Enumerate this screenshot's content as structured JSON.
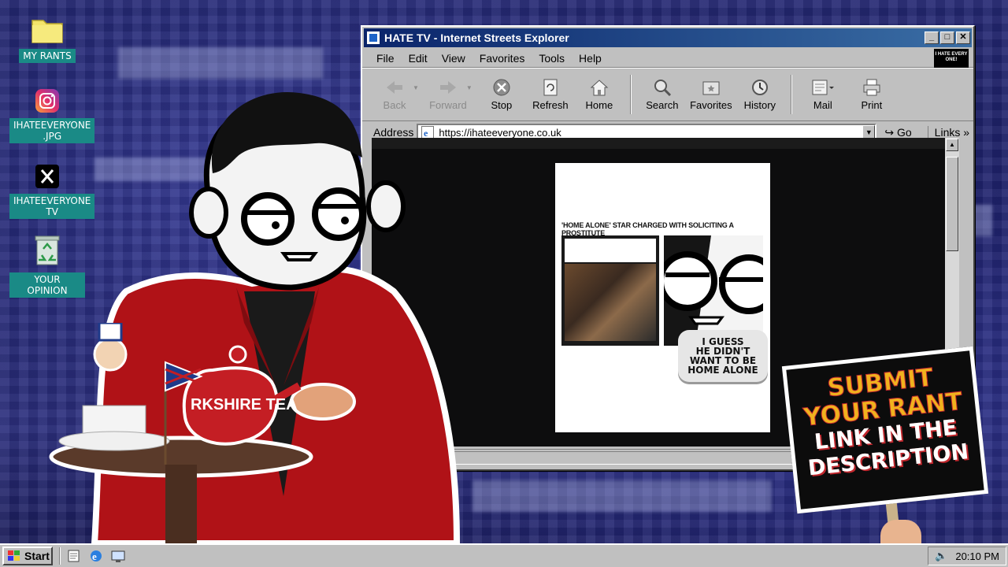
{
  "desktop": {
    "icons": [
      {
        "label": "MY RANTS",
        "icon": "folder-icon"
      },
      {
        "label": "IHATEEVERYONE\n.JPG",
        "icon": "instagram-icon"
      },
      {
        "label": "IHATEEVERYONE\nTV",
        "icon": "x-icon"
      },
      {
        "label": "YOUR OPINION",
        "icon": "recycle-bin-icon"
      }
    ]
  },
  "window": {
    "title": "HATE TV - Internet Streets Explorer",
    "controls": {
      "minimize": "_",
      "maximize": "□",
      "close": "✕"
    },
    "menu": [
      "File",
      "Edit",
      "View",
      "Favorites",
      "Tools",
      "Help"
    ],
    "brand_logo": "I HATE EVERY ONE!",
    "toolbar": {
      "back": "Back",
      "forward": "Forward",
      "stop": "Stop",
      "refresh": "Refresh",
      "home": "Home",
      "search": "Search",
      "favorites": "Favorites",
      "history": "History",
      "mail": "Mail",
      "print": "Print"
    },
    "address": {
      "label": "Address",
      "url": "https://ihateeveryone.co.uk",
      "go": "Go",
      "links": "Links"
    },
    "page": {
      "headline": "'HOME ALONE' STAR CHARGED WITH SOLICITING A PROSTITUTE",
      "bubble_text": "I GUESS\nHE DIDN'T\nWANT TO BE\nHOME ALONE"
    }
  },
  "overlay": {
    "sign_line1": "SUBMIT",
    "sign_line2": "YOUR RANT",
    "sign_line3": "LINK IN THE",
    "sign_line4": "DESCRIPTION",
    "teapot_brand": "RKSHIRE TEA"
  },
  "taskbar": {
    "start_label": "Start",
    "clock": "20:10 PM"
  },
  "colors": {
    "title_bar_start": "#0a246a",
    "title_bar_end": "#3a6ea5",
    "desktop_label_bg": "#1a8a86",
    "sign_yellow": "#f0b21e",
    "sign_red": "#c1272d",
    "jacket_red": "#b01217"
  }
}
